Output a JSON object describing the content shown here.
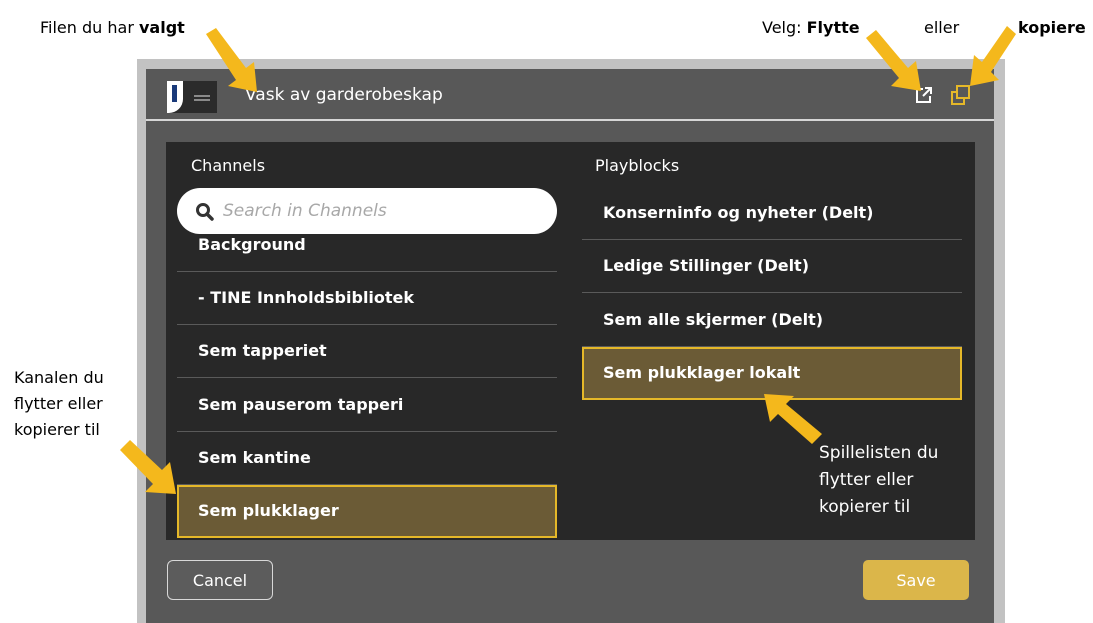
{
  "annotations": {
    "selected_file": {
      "prefix": "Filen du har ",
      "bold": "valgt"
    },
    "choose": {
      "prefix": "Velg: ",
      "bold": "Flytte"
    },
    "or": "eller",
    "copy": "kopiere",
    "channel_note": [
      "Kanalen du",
      "flytter eller",
      "kopierer til"
    ],
    "playlist_note": [
      "Spillelisten du",
      "flytter eller",
      "kopierer til"
    ]
  },
  "dialog": {
    "title": "Vask av garderobeskap",
    "icons": {
      "move": "external-move-icon",
      "copy": "copy-icon"
    },
    "channels": {
      "heading": "Channels",
      "search_placeholder": "Search in Channels",
      "items": [
        {
          "label": "Background",
          "selected": false
        },
        {
          "label": "- TINE Innholdsbibliotek",
          "selected": false
        },
        {
          "label": "Sem tapperiet",
          "selected": false
        },
        {
          "label": "Sem pauserom tapperi",
          "selected": false
        },
        {
          "label": "Sem kantine",
          "selected": false
        },
        {
          "label": "Sem plukklager",
          "selected": true
        }
      ]
    },
    "playblocks": {
      "heading": "Playblocks",
      "items": [
        {
          "label": "Konserninfo og nyheter (Delt)",
          "selected": false
        },
        {
          "label": "Ledige Stillinger (Delt)",
          "selected": false
        },
        {
          "label": "Sem alle skjermer (Delt)",
          "selected": false
        },
        {
          "label": "Sem plukklager lokalt",
          "selected": true
        }
      ]
    },
    "cancel_label": "Cancel",
    "save_label": "Save"
  },
  "colors": {
    "dialog_bg": "#585858",
    "panel_bg": "#282828",
    "selection_border": "#e5b829",
    "selection_fill": "#6b5b36",
    "save_button": "#dbb64a",
    "arrow": "#f4b81c"
  }
}
